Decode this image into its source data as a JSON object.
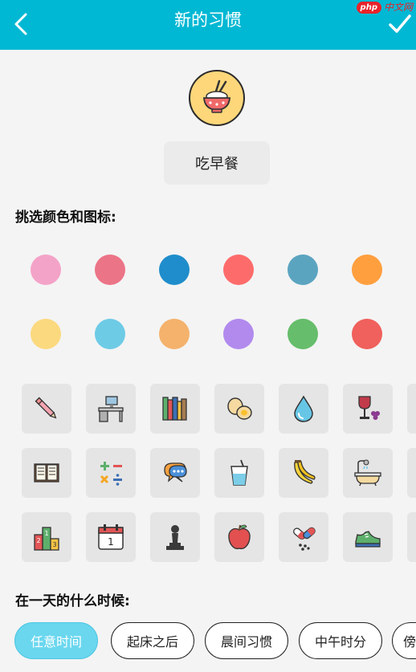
{
  "header": {
    "title": "新的习惯",
    "back_icon": "back-arrow-icon",
    "confirm_icon": "checkmark-icon"
  },
  "watermark": {
    "badge": "php",
    "text": "中文网"
  },
  "habit": {
    "icon": "rice-bowl-icon",
    "name": "吃早餐"
  },
  "sections": {
    "pick_label": "挑选颜色和图标:",
    "time_label": "在一天的什么时候:"
  },
  "colors": [
    "#f4a3c8",
    "#ec7487",
    "#1f8dcb",
    "#fd6c6b",
    "#5ba4c0",
    "#ff9f3e",
    "#fbd97f",
    "#6dcbe6",
    "#f4b26c",
    "#b28aee",
    "#66bd6b",
    "#f0605c"
  ],
  "icons": [
    "pencil-icon",
    "desk-icon",
    "books-icon",
    "eggs-icon",
    "water-drop-icon",
    "wine-icon",
    "open-book-icon",
    "math-icon",
    "chat-icon",
    "drink-cup-icon",
    "banana-icon",
    "bathtub-icon",
    "podium-icon",
    "calendar-icon",
    "chess-pawn-icon",
    "apple-icon",
    "pills-icon",
    "sneaker-icon"
  ],
  "calendar_day": "1",
  "podium_ranks": [
    "1",
    "2",
    "3"
  ],
  "time_options": [
    {
      "label": "任意时间",
      "selected": true
    },
    {
      "label": "起床之后",
      "selected": false
    },
    {
      "label": "晨间习惯",
      "selected": false
    },
    {
      "label": "中午时分",
      "selected": false
    },
    {
      "label": "傍晚",
      "selected": false
    }
  ]
}
